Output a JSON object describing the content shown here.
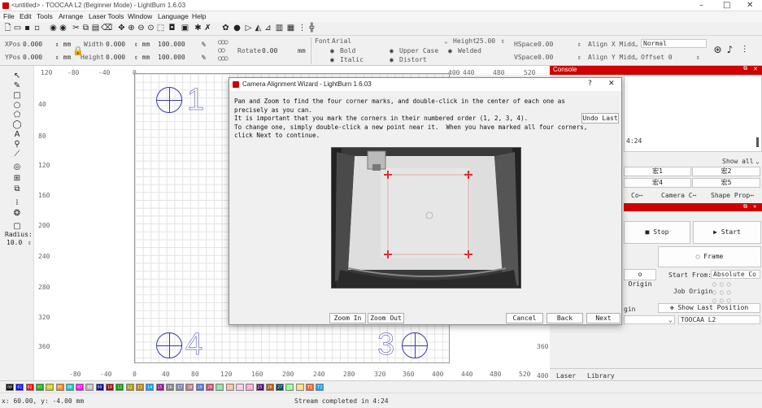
{
  "app": {
    "window_title": "<untitled> - TOOCAA L2 (Beginner Mode) - LightBurn 1.6.03",
    "menu": [
      "File",
      "Edit",
      "Tools",
      "Arrange",
      "Laser Tools",
      "Window",
      "Language",
      "Help"
    ]
  },
  "props": {
    "xpos_label": "XPos",
    "xpos": "0.000",
    "ypos_label": "YPos",
    "ypos": "0.000",
    "width_label": "Width",
    "width": "0.000",
    "height_label": "Height",
    "height": "0.000",
    "unit": "mm",
    "pct1": "100.000",
    "pct2": "100.000",
    "pct": "%",
    "rotate_label": "Rotate",
    "rotate": "0.00",
    "rotate_unit": "mm",
    "font_label": "Font",
    "font": "Arial",
    "bold": "Bold",
    "italic": "Italic",
    "upper_case": "Upper Case",
    "distort": "Distort",
    "welded": "Welded",
    "height2_label": "Height",
    "height2": "25.00",
    "hspace_label": "HSpace",
    "hspace": "0.00",
    "vspace_label": "VSpace",
    "vspace": "0.00",
    "align_x": "Align X Midd",
    "align_y": "Align Y Midd",
    "normal": "Normal",
    "offset": "Offset 0"
  },
  "leftpanel": {
    "radius_label": "Radius:",
    "radius": "10.0"
  },
  "ruler": {
    "top": [
      "120",
      "-80",
      "-40",
      "0",
      "40",
      "80",
      "120",
      "160",
      "200",
      "240",
      "280",
      "320",
      "360",
      "400",
      "440",
      "480",
      "520"
    ],
    "left": [
      "40",
      "80",
      "120",
      "160",
      "200",
      "240",
      "280",
      "320",
      "360"
    ],
    "bottom": [
      "-80",
      "-40",
      "0",
      "40",
      "80",
      "120",
      "160",
      "200",
      "240",
      "280",
      "320",
      "360",
      "400",
      "440",
      "480",
      "520"
    ],
    "right": [
      "360",
      "400"
    ]
  },
  "marks": {
    "m1": "1",
    "m2": "4",
    "m3": "3"
  },
  "console": {
    "title": "Console",
    "time": "4:24",
    "show_all": "Show all"
  },
  "macros": [
    "宏1",
    "宏2",
    "宏4",
    "宏5"
  ],
  "tabs_right": [
    "Co⋯",
    "Camera C⋯",
    "Shape Prop⋯"
  ],
  "laser": {
    "stop": "Stop",
    "start": "Start",
    "frame": "Frame",
    "origin": "o Origin",
    "start_from_label": "Start From:",
    "start_from": "Absolute Co",
    "job_origin": "Job Origin",
    "show_last": "Show Last Position",
    "gin": "gin",
    "device": "TOOCAA L2"
  },
  "bottom_tabs": [
    "Laser",
    "Library"
  ],
  "palette": [
    "00",
    "01",
    "02",
    "03",
    "04",
    "05",
    "06",
    "07",
    "08",
    "09",
    "10",
    "11",
    "12",
    "13",
    "14",
    "15",
    "16",
    "17",
    "18",
    "19",
    "20",
    "21",
    "22",
    "23",
    "24",
    "25",
    "26",
    "27",
    "28",
    "29",
    "T1",
    "T2"
  ],
  "palette_colors": [
    "#000000",
    "#0000ff",
    "#ff0000",
    "#00aa00",
    "#c8c800",
    "#ff8000",
    "#00c8c8",
    "#ff00ff",
    "#b4b4b4",
    "#0000a0",
    "#a00000",
    "#00a000",
    "#a0a000",
    "#c08000",
    "#00a0ff",
    "#a000a0",
    "#808080",
    "#7d87b9",
    "#bb7784",
    "#4a6fe3",
    "#d33f6a",
    "#8cd78c",
    "#f0b98d",
    "#f6c4e1",
    "#fa9ed4",
    "#500a78",
    "#b45a00",
    "#004754",
    "#86fa88",
    "#ffdb66",
    "#f36926",
    "#1fa1e8"
  ],
  "status": {
    "coords": "x: 60.00, y: -4.00 mm",
    "message": "Stream completed in 4:24"
  },
  "dialog": {
    "title": "Camera Alignment Wizard - LightBurn 1.6.03",
    "help": "?",
    "close": "✕",
    "instructions": "Pan and Zoom to find the four corner marks, and double-click in the center of each one as\nprecisely as you can.\nIt is important that you mark the corners in their numbered order (1, 2, 3, 4).\nTo change one, simply double-click a new point near it.  When you have marked all four corners,\nclick Next to continue.",
    "undo_last": "Undo Last",
    "zoom_in": "Zoom In",
    "zoom_out": "Zoom Out",
    "cancel": "Cancel",
    "back": "Back",
    "next": "Next"
  }
}
